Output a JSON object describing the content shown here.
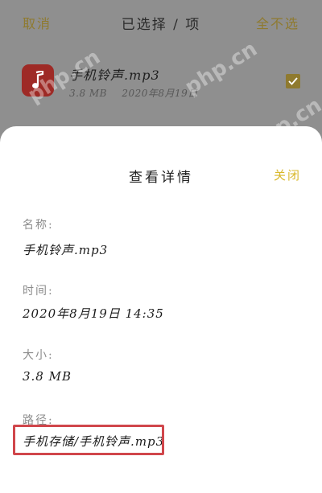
{
  "topbar": {
    "cancel_label": "取消",
    "title": "已选择 / 项",
    "select_none_label": "全不选"
  },
  "file": {
    "name": "手机铃声.mp3",
    "size": "3.8 MB",
    "date": "2020年8月19日",
    "icon": "music-note-icon",
    "checked": true
  },
  "sheet": {
    "title": "查看详情",
    "close_label": "关闭",
    "fields": [
      {
        "label": "名称:",
        "value": "手机铃声.mp3"
      },
      {
        "label": "时间:",
        "value": "2020年8月19日 14:35"
      },
      {
        "label": "大小:",
        "value": "3.8 MB"
      },
      {
        "label": "路径:",
        "value": "手机存储/手机铃声.mp3"
      }
    ]
  },
  "colors": {
    "accent": "#d9b82a",
    "highlight": "#d0464b",
    "icon_bg": "#9e2a26"
  },
  "watermark": "php.cn"
}
